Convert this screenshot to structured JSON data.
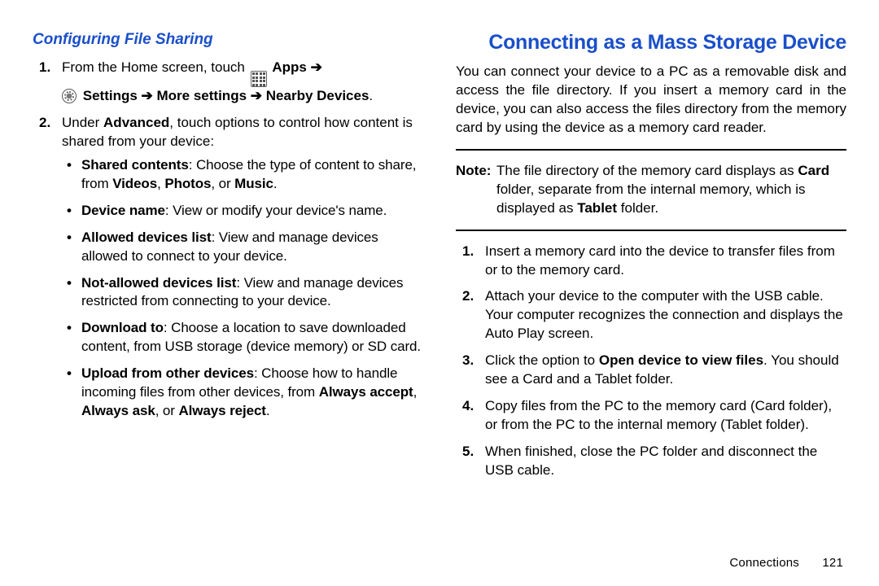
{
  "left": {
    "subheading": "Configuring File Sharing",
    "step1": {
      "marker": "1.",
      "lead": "From the Home screen, touch",
      "apps_label": "Apps",
      "arrow": "➔",
      "settings_label": "Settings",
      "more_label": "More settings",
      "nearby_label": "Nearby Devices",
      "period": "."
    },
    "step2": {
      "marker": "2.",
      "lead": "Under ",
      "advanced": "Advanced",
      "tail": ", touch options to control how content is shared from your device:"
    },
    "bullets": {
      "b1": {
        "bold": "Shared contents",
        "text1": ": Choose the type of content to share, from ",
        "v": "Videos",
        "sep1": ", ",
        "p": "Photos",
        "sep2": ", or ",
        "m": "Music",
        "end": "."
      },
      "b2": {
        "bold": "Device name",
        "text": ": View or modify your device's name."
      },
      "b3": {
        "bold": "Allowed devices list",
        "text": ": View and manage devices allowed to connect to your device."
      },
      "b4": {
        "bold": "Not-allowed devices list",
        "text": ": View and manage devices restricted from connecting to your device."
      },
      "b5": {
        "bold": "Download to",
        "text": ": Choose a location to save downloaded content, from USB storage (device memory) or SD card."
      },
      "b6": {
        "bold": "Upload from other devices",
        "text1": ": Choose how to handle incoming files from other devices, from ",
        "a1": "Always accept",
        "sep1": ", ",
        "a2": "Always ask",
        "sep2": ", or ",
        "a3": "Always reject",
        "end": "."
      }
    }
  },
  "right": {
    "heading": "Connecting as a Mass Storage Device",
    "intro": "You can connect your device to a PC as a removable disk and access the file directory. If you insert a memory card in the device, you can also access the files directory from the memory card by using the device as a memory card reader.",
    "note": {
      "label": "Note:",
      "t1": "The file directory of the memory card displays as ",
      "card": "Card",
      "t2": " folder, separate from the internal memory, which is displayed as ",
      "tablet": "Tablet",
      "t3": " folder."
    },
    "steps": {
      "s1": {
        "marker": "1.",
        "text": "Insert a memory card into the device to transfer files from or to the memory card."
      },
      "s2": {
        "marker": "2.",
        "text": "Attach your device to the computer with the USB cable. Your computer recognizes the connection and displays the Auto Play screen."
      },
      "s3": {
        "marker": "3.",
        "t1": "Click the option to ",
        "bold": "Open device to view files",
        "t2": ". You should see a Card and a Tablet folder."
      },
      "s4": {
        "marker": "4.",
        "text": "Copy files from the PC to the memory card (Card folder), or from the PC to the internal memory (Tablet folder)."
      },
      "s5": {
        "marker": "5.",
        "text": "When finished, close the PC folder and disconnect the USB cable."
      }
    }
  },
  "footer": {
    "section": "Connections",
    "page": "121"
  }
}
